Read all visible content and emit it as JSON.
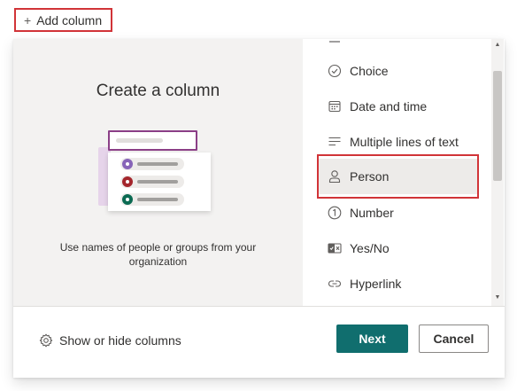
{
  "toolbar": {
    "add_column_label": "Add column",
    "add_column_icon": "plus-icon"
  },
  "panel": {
    "title": "Create a column",
    "description": "Use names of people or groups from your organization",
    "column_types": [
      {
        "label": "Choice",
        "icon": "check-circle-icon"
      },
      {
        "label": "Date and time",
        "icon": "calendar-icon"
      },
      {
        "label": "Multiple lines of text",
        "icon": "text-lines-icon"
      },
      {
        "label": "Person",
        "icon": "person-icon",
        "selected": true
      },
      {
        "label": "Number",
        "icon": "number-one-icon"
      },
      {
        "label": "Yes/No",
        "icon": "toggle-icon"
      },
      {
        "label": "Hyperlink",
        "icon": "link-icon"
      }
    ],
    "footer": {
      "show_hide_label": "Show or hide columns",
      "next_label": "Next",
      "cancel_label": "Cancel"
    }
  },
  "colors": {
    "accent": "#106e6e",
    "highlight_outline": "#d13438",
    "selected_bg": "#edebe9",
    "illustration_purple": "#8b3f87"
  }
}
